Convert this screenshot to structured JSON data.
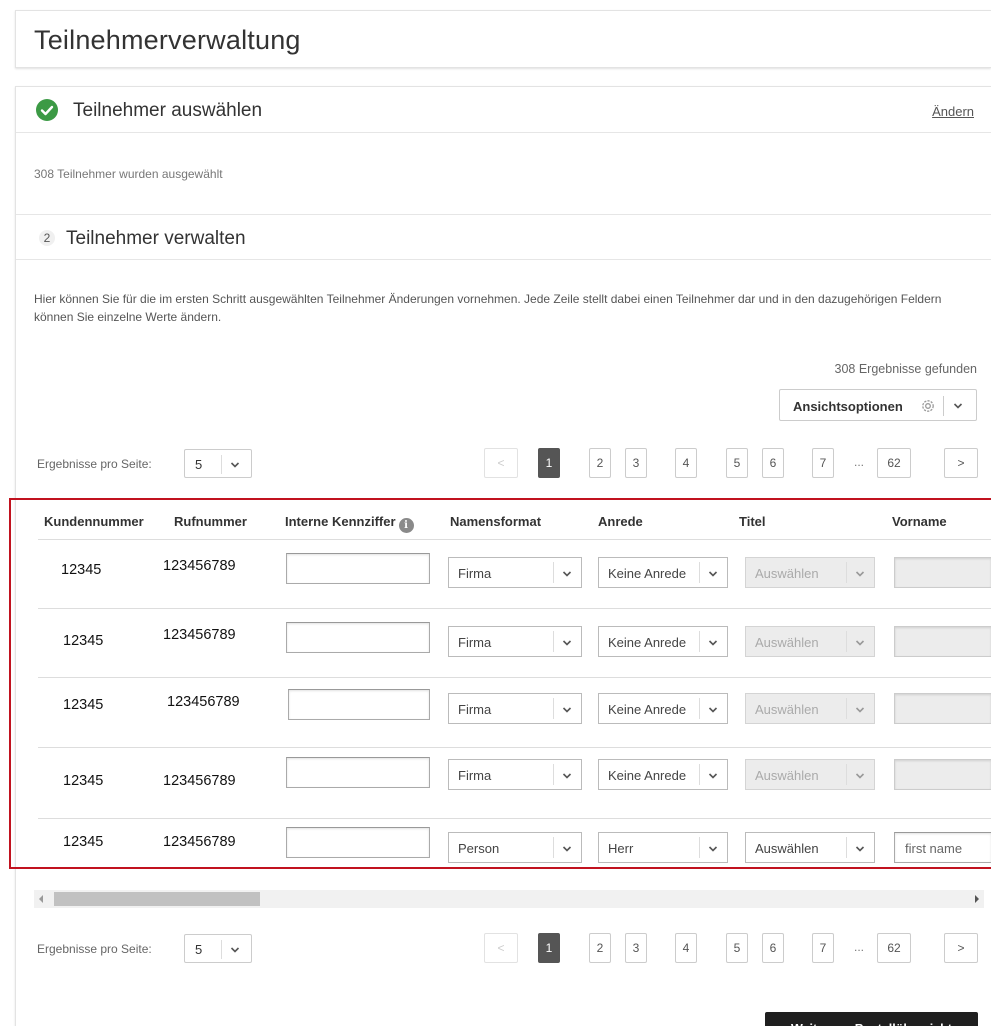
{
  "page": {
    "title": "Teilnehmerverwaltung"
  },
  "step1": {
    "title": "Teilnehmer auswählen",
    "change_label": "Ändern",
    "summary": "308 Teilnehmer wurden ausgewählt"
  },
  "step2": {
    "number": "2",
    "title": "Teilnehmer verwalten",
    "description": "Hier können Sie für die im ersten Schritt ausgewählten Teilnehmer Änderungen vornehmen. Jede Zeile stellt dabei einen Teilnehmer dar und in den dazugehörigen Feldern können Sie einzelne Werte ändern.",
    "results_count": "308 Ergebnisse gefunden",
    "view_options_label": "Ansichtsoptionen"
  },
  "pagination": {
    "per_page_label": "Ergebnisse pro Seite:",
    "per_page_value": "5",
    "prev": "<",
    "next": ">",
    "pages": [
      "1",
      "2",
      "3",
      "4",
      "5",
      "6",
      "7"
    ],
    "ellipsis": "...",
    "last_page": "62",
    "current_page": "1"
  },
  "table": {
    "columns": [
      "Kundennummer",
      "Rufnummer",
      "Interne Kennziffer",
      "Namensformat",
      "Anrede",
      "Titel",
      "Vorname"
    ],
    "rows": [
      {
        "kundennummer": "12345",
        "rufnummer": "123456789",
        "interne_kennziffer": "",
        "namensformat": "Firma",
        "anrede": "Keine Anrede",
        "titel": "Auswählen",
        "titel_disabled": true,
        "vorname": "",
        "vorname_disabled": true
      },
      {
        "kundennummer": "12345",
        "rufnummer": "123456789",
        "interne_kennziffer": "",
        "namensformat": "Firma",
        "anrede": "Keine Anrede",
        "titel": "Auswählen",
        "titel_disabled": true,
        "vorname": "",
        "vorname_disabled": true
      },
      {
        "kundennummer": "12345",
        "rufnummer": "123456789",
        "interne_kennziffer": "",
        "namensformat": "Firma",
        "anrede": "Keine Anrede",
        "titel": "Auswählen",
        "titel_disabled": true,
        "vorname": "",
        "vorname_disabled": true
      },
      {
        "kundennummer": "12345",
        "rufnummer": "123456789",
        "interne_kennziffer": "",
        "namensformat": "Firma",
        "anrede": "Keine Anrede",
        "titel": "Auswählen",
        "titel_disabled": true,
        "vorname": "",
        "vorname_disabled": true
      },
      {
        "kundennummer": "12345",
        "rufnummer": "123456789",
        "interne_kennziffer": "",
        "namensformat": "Person",
        "anrede": "Herr",
        "titel": "Auswählen",
        "titel_disabled": false,
        "vorname": "first name",
        "vorname_disabled": false
      }
    ]
  },
  "footer": {
    "continue_label": "Weiter zur Bestellübersicht"
  },
  "colors": {
    "success": "#3c9a45",
    "active_page": "#555555",
    "primary_button": "#1f1f1f",
    "highlight": "#c1121f"
  },
  "icons": {
    "step1": "check-circle-icon",
    "view_options": "gear-icon",
    "dropdown": "chevron-down-icon",
    "column_help": "info-icon"
  }
}
